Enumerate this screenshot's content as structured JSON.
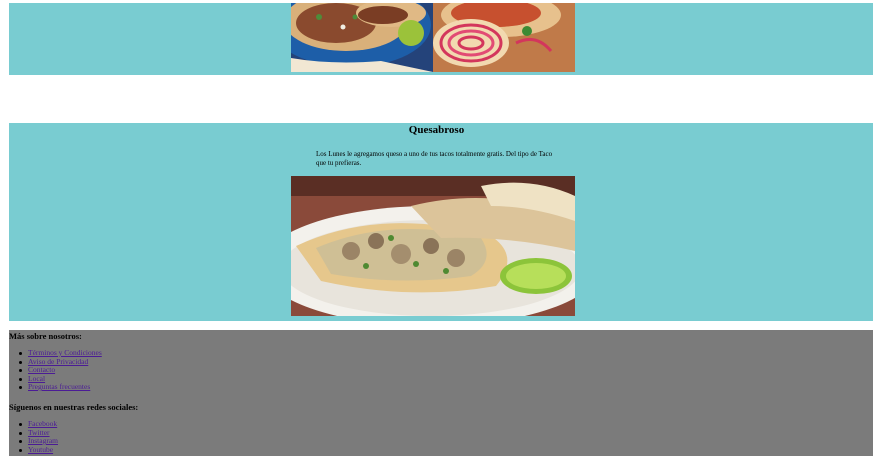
{
  "promo": {
    "title": "Quesabroso",
    "description": "Los Lunes le agregamos queso a uno de tus tacos totalmente gratis. Del tipo de Taco que tu prefieras."
  },
  "footer": {
    "about_heading": "Más sobre nosotros:",
    "about_links": [
      "Términos y Condiciones",
      "Aviso de Privacidad",
      "Contacto",
      "Local",
      "Preguntas frecuentes"
    ],
    "social_heading": "Síguenos en nuestras redes sociales:",
    "social_links": [
      "Facebook",
      "Twitter",
      "Instagram",
      "Youtube"
    ]
  },
  "colors": {
    "band": "#79ccd1",
    "footer": "#7b7b7b",
    "link": "#4b1b96"
  }
}
